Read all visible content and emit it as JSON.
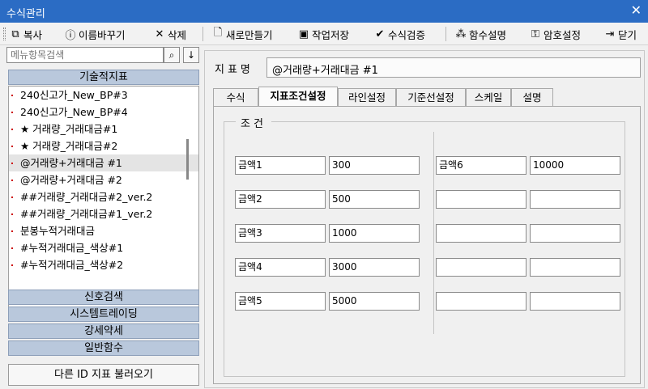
{
  "window": {
    "title": "수식관리",
    "close": "✕"
  },
  "toolbar": {
    "copy": "복사",
    "rename": "이름바꾸기",
    "delete": "삭제",
    "new": "새로만들기",
    "save": "작업저장",
    "verify": "수식검증",
    "func_help": "함수설명",
    "password": "암호설정",
    "close": "닫기"
  },
  "left": {
    "search_placeholder": "메뉴항목검색",
    "sections": {
      "technical": "기술적지표",
      "signal": "신호검색",
      "system": "시스템트레이딩",
      "strength": "강세약세",
      "general": "일반함수"
    },
    "items": [
      "240신고가_New_BP#3",
      "240신고가_New_BP#4",
      "★ 거래량_거래대금#1",
      "★ 거래량_거래대금#2",
      "@거래량+거래대금 #1",
      "@거래량+거래대금 #2",
      "##거래량_거래대금#2_ver.2",
      "##거래량_거래대금#1_ver.2",
      "분봉누적거래대금",
      "#누적거래대금_색상#1",
      "#누적거래대금_색상#2"
    ],
    "selected_index": 4,
    "load_other": "다른 ID 지표 불러오기"
  },
  "right": {
    "name_label": "지표명",
    "name_value": "@거래량+거래대금 #1",
    "tabs": [
      "수식",
      "지표조건설정",
      "라인설정",
      "기준선설정",
      "스케일",
      "설명"
    ],
    "active_tab": 1,
    "group_title": "조건",
    "conditions": [
      {
        "label": "금액1",
        "value": "300"
      },
      {
        "label": "금액2",
        "value": "500"
      },
      {
        "label": "금액3",
        "value": "1000"
      },
      {
        "label": "금액4",
        "value": "3000"
      },
      {
        "label": "금액5",
        "value": "5000"
      },
      {
        "label": "금액6",
        "value": "10000"
      },
      {
        "label": "",
        "value": ""
      },
      {
        "label": "",
        "value": ""
      },
      {
        "label": "",
        "value": ""
      },
      {
        "label": "",
        "value": ""
      }
    ]
  },
  "colors": {
    "titlebar": "#2b6cc4",
    "section_header": "#b9c8dc",
    "selected_row": "#e4e4e4"
  }
}
